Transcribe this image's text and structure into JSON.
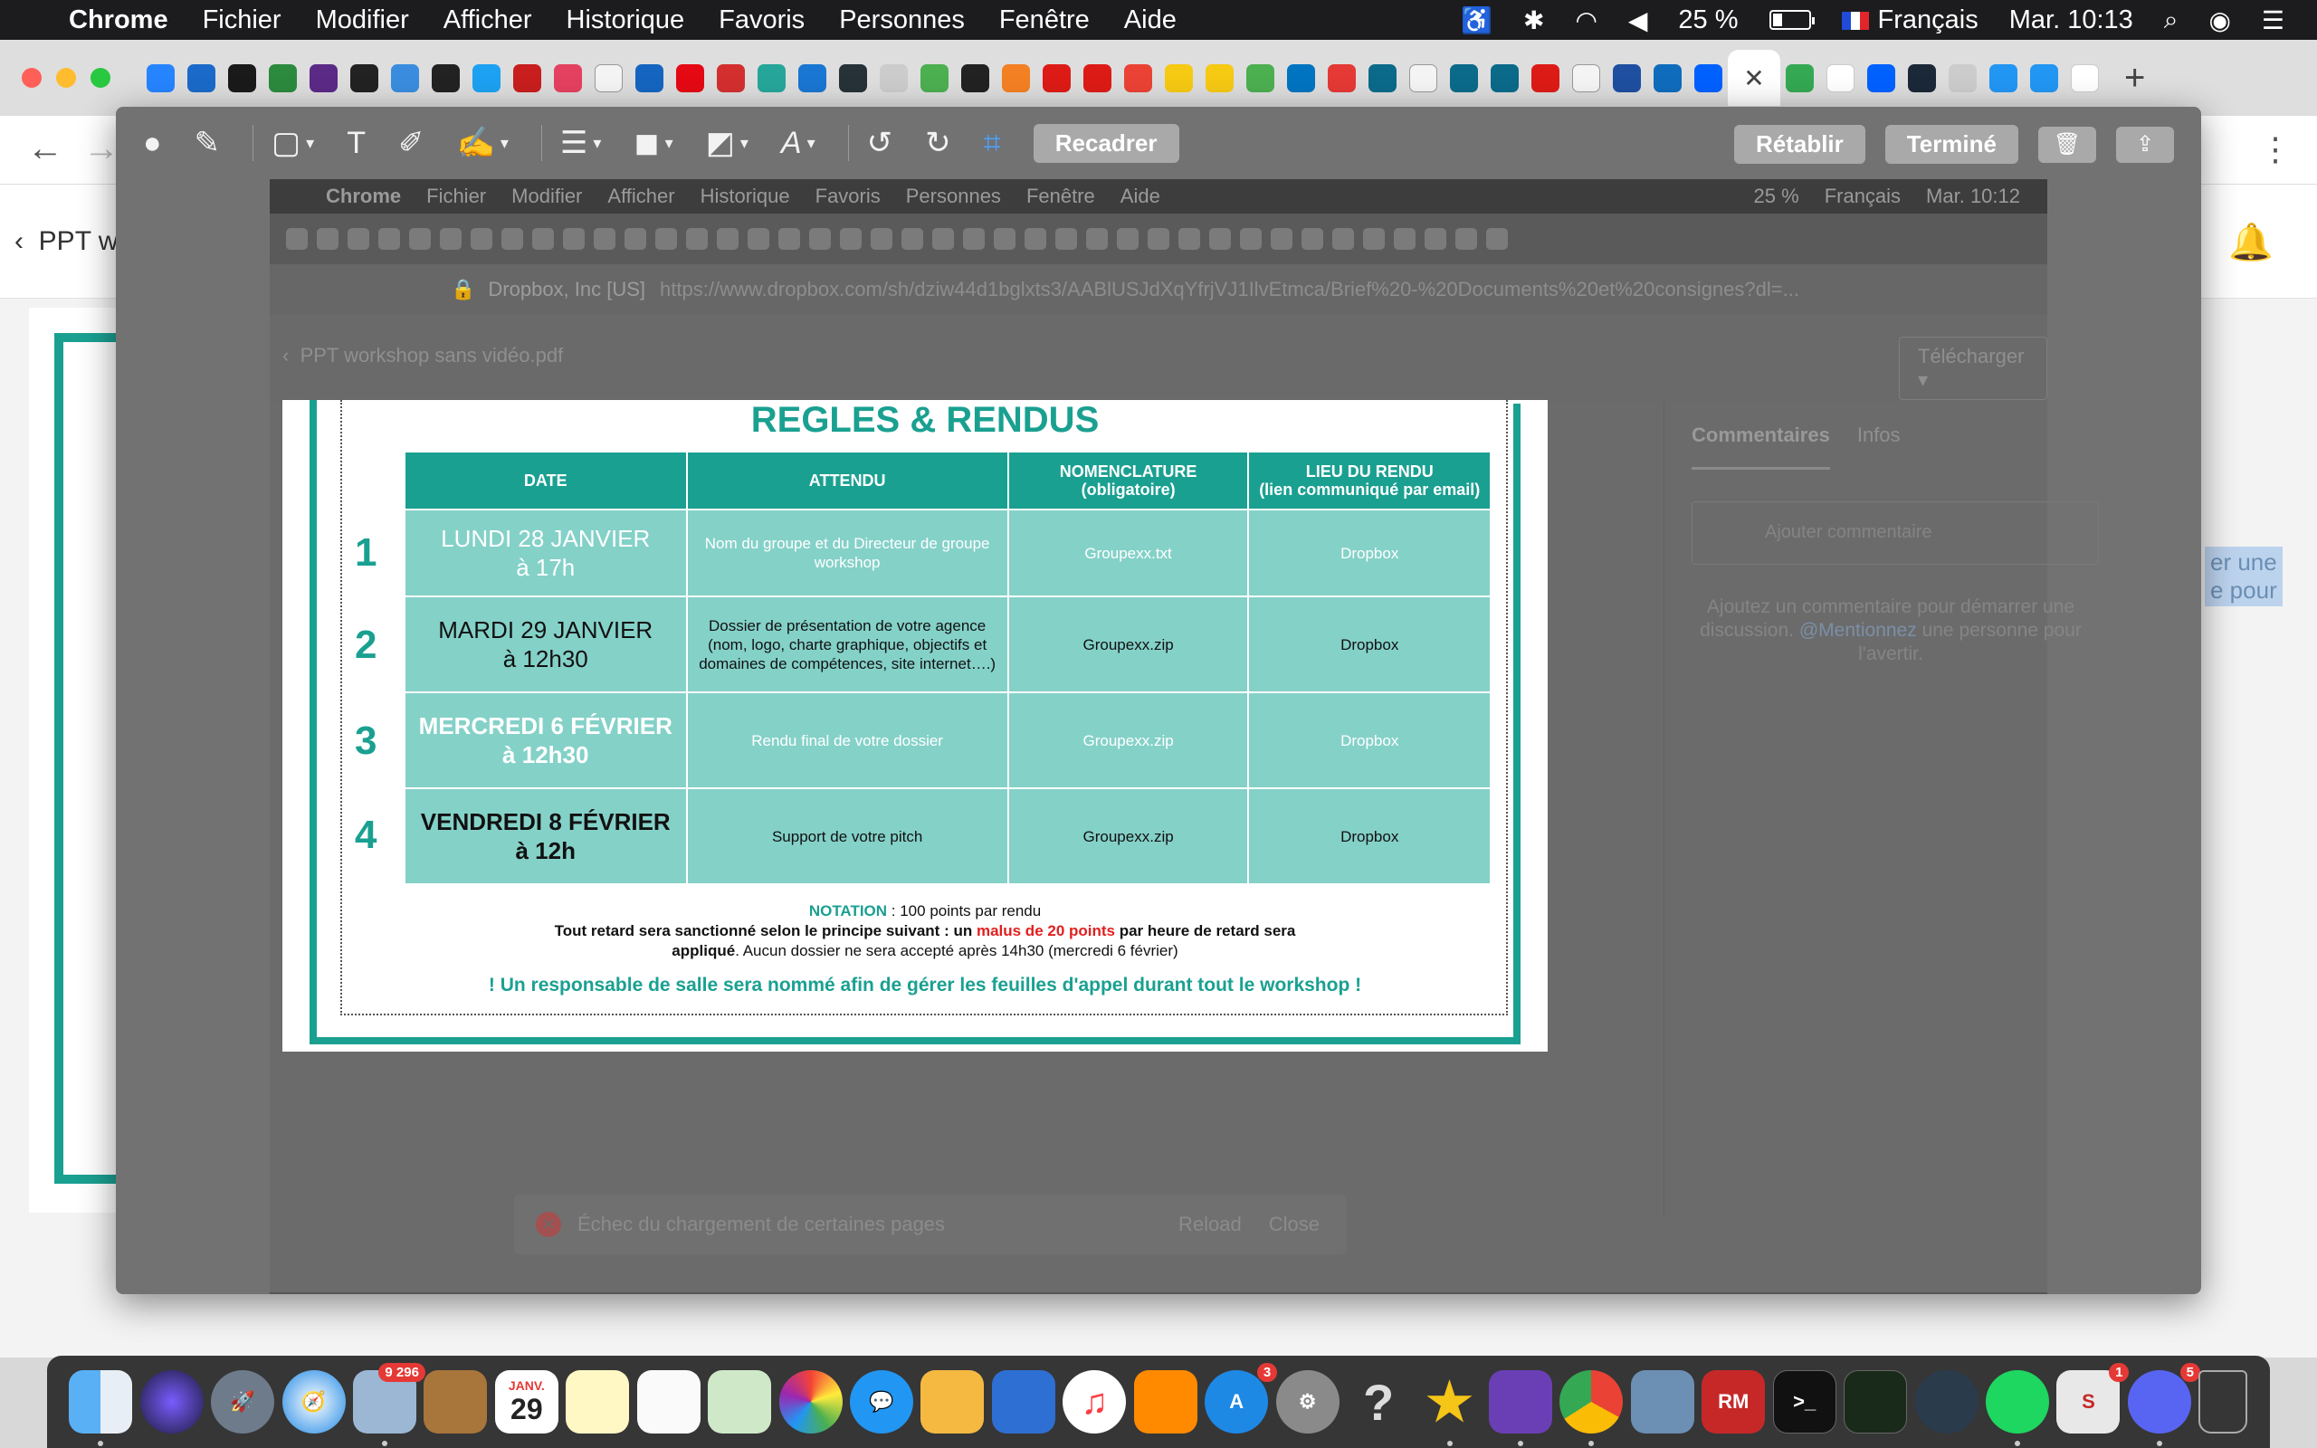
{
  "menubar": {
    "app": "Chrome",
    "items": [
      "Fichier",
      "Modifier",
      "Afficher",
      "Historique",
      "Favoris",
      "Personnes",
      "Fenêtre",
      "Aide"
    ],
    "battery": "25 %",
    "language": "Français",
    "clock": "Mar. 10:13"
  },
  "background_page": {
    "title": "PPT w",
    "selected_text_1": "er une",
    "selected_text_2": "e pour"
  },
  "markup_toolbar": {
    "crop_label": "Recadrer",
    "revert_label": "Rétablir",
    "done_label": "Terminé"
  },
  "inner": {
    "menubar": {
      "app": "Chrome",
      "items": [
        "Fichier",
        "Modifier",
        "Afficher",
        "Historique",
        "Favoris",
        "Personnes",
        "Fenêtre",
        "Aide"
      ],
      "battery": "25 %",
      "language": "Français",
      "clock": "Mar. 10:12"
    },
    "site_identity": "Dropbox, Inc [US]",
    "url": "https://www.dropbox.com/sh/dziw44d1bglxts3/AABlUSJdXqYfrjVJ1IlvEtmca/Brief%20-%20Documents%20et%20consignes?dl=...",
    "doc_title": "PPT workshop sans vidéo.pdf",
    "download_label": "Télécharger ▾",
    "comments_tab": "Commentaires",
    "infos_tab": "Infos",
    "comment_placeholder": "Ajouter commentaire",
    "comment_hint": "Ajoutez un commentaire pour démarrer une discussion.",
    "comment_hint_mention": "@Mentionnez",
    "comment_hint_tail": "une personne pour l'avertir.",
    "toast": "Échec du chargement de certaines pages",
    "toast_reload": "Reload",
    "toast_close": "Close"
  },
  "slide": {
    "title": "REGLES & RENDUS",
    "headers": {
      "date": "DATE",
      "attendu": "ATTENDU",
      "nomenclature": "NOMENCLATURE",
      "nomenclature_sub": "(obligatoire)",
      "lieu": "LIEU DU RENDU",
      "lieu_sub": "(lien communiqué par email)"
    },
    "rows": [
      {
        "num": "1",
        "date_line1": "LUNDI 28 JANVIER",
        "date_line2": "à 17h",
        "attendu": "Nom du groupe et du Directeur de groupe workshop",
        "nomenclature": "Groupexx.txt",
        "lieu": "Dropbox"
      },
      {
        "num": "2",
        "date_line1": "MARDI 29 JANVIER",
        "date_line2": "à 12h30",
        "attendu": "Dossier de présentation de votre agence (nom, logo, charte graphique, objectifs et domaines de compétences, site internet….)",
        "nomenclature": "Groupexx.zip",
        "lieu": "Dropbox"
      },
      {
        "num": "3",
        "date_line1": "MERCREDI 6 FÉVRIER",
        "date_line2": "à 12h30",
        "attendu": "Rendu final de votre dossier",
        "nomenclature": "Groupexx.zip",
        "lieu": "Dropbox"
      },
      {
        "num": "4",
        "date_line1": "VENDREDI 8 FÉVRIER",
        "date_line2": "à 12h",
        "attendu": "Support de votre pitch",
        "nomenclature": "Groupexx.zip",
        "lieu": "Dropbox"
      }
    ],
    "notation_label": "NOTATION",
    "notation_text": " : 100 points par rendu",
    "penalty_a": "Tout retard sera sanctionné selon le principe suivant : un ",
    "penalty_red": "malus de 20 points",
    "penalty_b": " par heure de retard sera",
    "penalty_c": "appliqué",
    "penalty_d": ". Aucun dossier ne sera accepté après 14h30 (mercredi 6 février)",
    "warning": "! Un responsable de salle sera nommé afin de gérer les feuilles d'appel durant tout le workshop !"
  },
  "dock": {
    "mail_badge": "9 296",
    "calendar_month": "JANV.",
    "calendar_day": "29",
    "appstore_badge": "3",
    "rm_label": "RM",
    "slack_badge": "1",
    "discord_badge": "5",
    "terminal_label": ">_"
  },
  "colors": {
    "teal": "#1aa091",
    "cell": "#84d1c8",
    "red": "#e02020"
  }
}
